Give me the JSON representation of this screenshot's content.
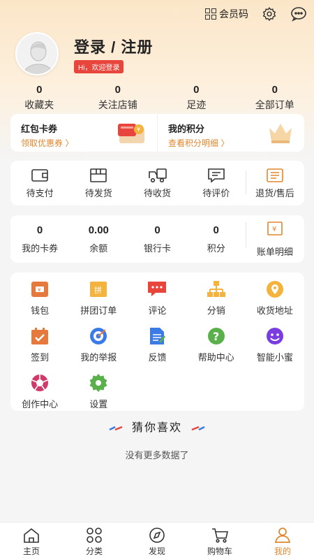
{
  "header": {
    "member_code_label": "会员码",
    "settings_icon": "gear-icon",
    "message_icon": "chat-bubble-icon"
  },
  "profile": {
    "login_label": "登录 / 注册",
    "welcome_badge": "Hi，欢迎登录"
  },
  "stats": [
    {
      "num": "0",
      "label": "收藏夹"
    },
    {
      "num": "0",
      "label": "关注店铺"
    },
    {
      "num": "0",
      "label": "足迹"
    },
    {
      "num": "0",
      "label": "全部订单"
    }
  ],
  "promo": {
    "coupon_title": "红包卡券",
    "coupon_sub": "领取优惠券 〉",
    "points_title": "我的积分",
    "points_sub": "查看积分明细 〉"
  },
  "orders": [
    {
      "label": "待支付",
      "icon": "wallet-icon"
    },
    {
      "label": "待发货",
      "icon": "package-icon"
    },
    {
      "label": "待收货",
      "icon": "truck-icon"
    },
    {
      "label": "待评价",
      "icon": "comment-icon"
    },
    {
      "label": "退货/售后",
      "icon": "return-icon"
    }
  ],
  "assets": [
    {
      "num": "0",
      "label": "我的卡券"
    },
    {
      "num": "0.00",
      "label": "余额"
    },
    {
      "num": "0",
      "label": "银行卡"
    },
    {
      "num": "0",
      "label": "积分"
    },
    {
      "num": "",
      "label": "账单明细",
      "icon": "bill-icon"
    }
  ],
  "tools": [
    {
      "label": "钱包",
      "icon": "wallet-icon",
      "color": "#e67a3d"
    },
    {
      "label": "拼团订单",
      "icon": "group-order-icon",
      "color": "#f3b33d"
    },
    {
      "label": "评论",
      "icon": "comment-icon",
      "color": "#e8453c"
    },
    {
      "label": "分销",
      "icon": "distribution-icon",
      "color": "#f3b33d"
    },
    {
      "label": "收货地址",
      "icon": "location-icon",
      "color": "#f3b33d"
    },
    {
      "label": "签到",
      "icon": "calendar-check-icon",
      "color": "#e67a3d"
    },
    {
      "label": "我的举报",
      "icon": "target-icon",
      "color": "#3b7be8"
    },
    {
      "label": "反馈",
      "icon": "feedback-icon",
      "color": "#3b7be8"
    },
    {
      "label": "帮助中心",
      "icon": "help-icon",
      "color": "#5ab04b"
    },
    {
      "label": "智能小蜜",
      "icon": "smiley-icon",
      "color": "#7a3de0"
    },
    {
      "label": "创作中心",
      "icon": "aperture-icon",
      "color": "#d03a6b"
    },
    {
      "label": "设置",
      "icon": "gear-icon",
      "color": "#5ab04b"
    }
  ],
  "guess_title": "猜你喜欢",
  "no_more": "没有更多数据了",
  "tabs": [
    {
      "label": "主页",
      "icon": "home-icon"
    },
    {
      "label": "分类",
      "icon": "category-icon"
    },
    {
      "label": "发现",
      "icon": "compass-icon"
    },
    {
      "label": "购物车",
      "icon": "cart-icon"
    },
    {
      "label": "我的",
      "icon": "user-icon",
      "active": true
    }
  ],
  "colors": {
    "accent": "#e0872f",
    "badge": "#e8453c"
  }
}
